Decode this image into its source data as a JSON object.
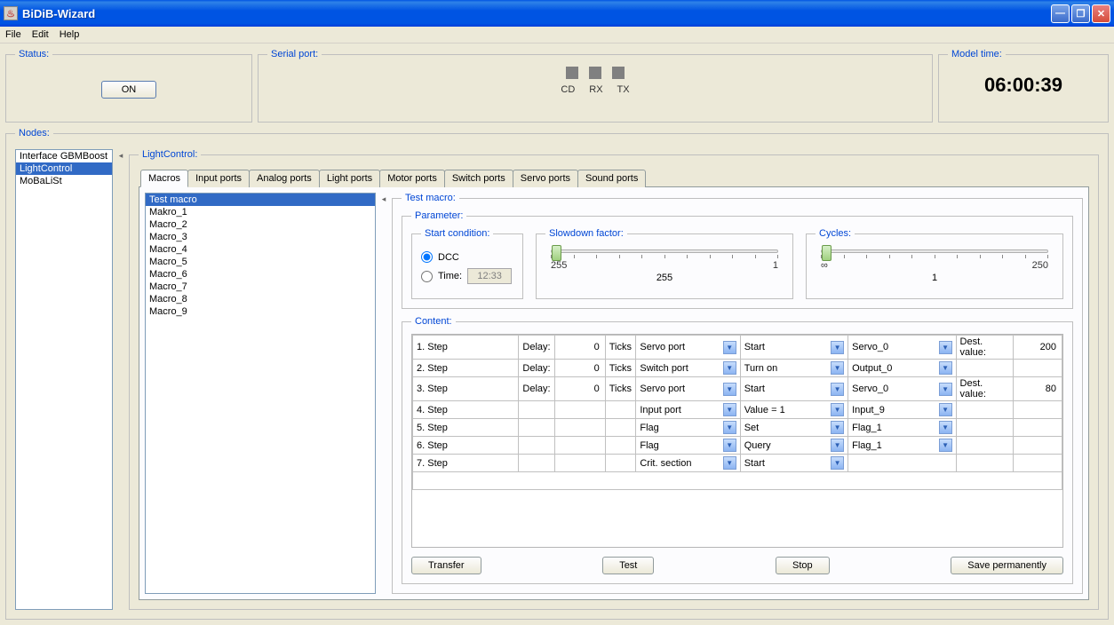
{
  "window": {
    "title": "BiDiB-Wizard"
  },
  "menu": {
    "file": "File",
    "edit": "Edit",
    "help": "Help"
  },
  "status": {
    "legend": "Status:",
    "button": "ON"
  },
  "serial": {
    "legend": "Serial port:",
    "cd": "CD",
    "rx": "RX",
    "tx": "TX"
  },
  "modeltime": {
    "legend": "Model time:",
    "value": "06:00:39"
  },
  "nodes": {
    "legend": "Nodes:",
    "items": [
      "Interface GBMBoost",
      "LightControl",
      "MoBaLiSt"
    ],
    "selected": 1
  },
  "lightcontrol": {
    "legend": "LightControl:"
  },
  "tabs": [
    "Macros",
    "Input ports",
    "Analog ports",
    "Light ports",
    "Motor ports",
    "Switch ports",
    "Servo ports",
    "Sound ports"
  ],
  "macros": {
    "list": [
      "Test macro",
      "Makro_1",
      "Macro_2",
      "Macro_3",
      "Macro_4",
      "Macro_5",
      "Macro_6",
      "Macro_7",
      "Macro_8",
      "Macro_9"
    ],
    "selected": 0,
    "detail_legend": "Test macro:",
    "param_legend": "Parameter:",
    "startcond": {
      "legend": "Start condition:",
      "dcc": "DCC",
      "time": "Time:",
      "time_value": "12:33"
    },
    "slowdown": {
      "legend": "Slowdown factor:",
      "min": "255",
      "max": "1",
      "center": "255"
    },
    "cycles": {
      "legend": "Cycles:",
      "min": "∞",
      "max": "250",
      "center": "1"
    },
    "content_legend": "Content:",
    "steps": [
      {
        "step": "1. Step",
        "delay_label": "Delay:",
        "delay": "0",
        "ticks": "Ticks",
        "port": "Servo port",
        "action": "Start",
        "target": "Servo_0",
        "dest_label": "Dest. value:",
        "dest": "200"
      },
      {
        "step": "2. Step",
        "delay_label": "Delay:",
        "delay": "0",
        "ticks": "Ticks",
        "port": "Switch port",
        "action": "Turn on",
        "target": "Output_0",
        "dest_label": "",
        "dest": ""
      },
      {
        "step": "3. Step",
        "delay_label": "Delay:",
        "delay": "0",
        "ticks": "Ticks",
        "port": "Servo port",
        "action": "Start",
        "target": "Servo_0",
        "dest_label": "Dest. value:",
        "dest": "80"
      },
      {
        "step": "4. Step",
        "delay_label": "",
        "delay": "",
        "ticks": "",
        "port": "Input port",
        "action": "Value = 1",
        "target": "Input_9",
        "dest_label": "",
        "dest": ""
      },
      {
        "step": "5. Step",
        "delay_label": "",
        "delay": "",
        "ticks": "",
        "port": "Flag",
        "action": "Set",
        "target": "Flag_1",
        "dest_label": "",
        "dest": ""
      },
      {
        "step": "6. Step",
        "delay_label": "",
        "delay": "",
        "ticks": "",
        "port": "Flag",
        "action": "Query",
        "target": "Flag_1",
        "dest_label": "",
        "dest": ""
      },
      {
        "step": "7. Step",
        "delay_label": "",
        "delay": "",
        "ticks": "",
        "port": "Crit. section",
        "action": "Start",
        "target": "",
        "dest_label": "",
        "dest": ""
      }
    ],
    "buttons": {
      "transfer": "Transfer",
      "test": "Test",
      "stop": "Stop",
      "save": "Save permanently"
    }
  }
}
